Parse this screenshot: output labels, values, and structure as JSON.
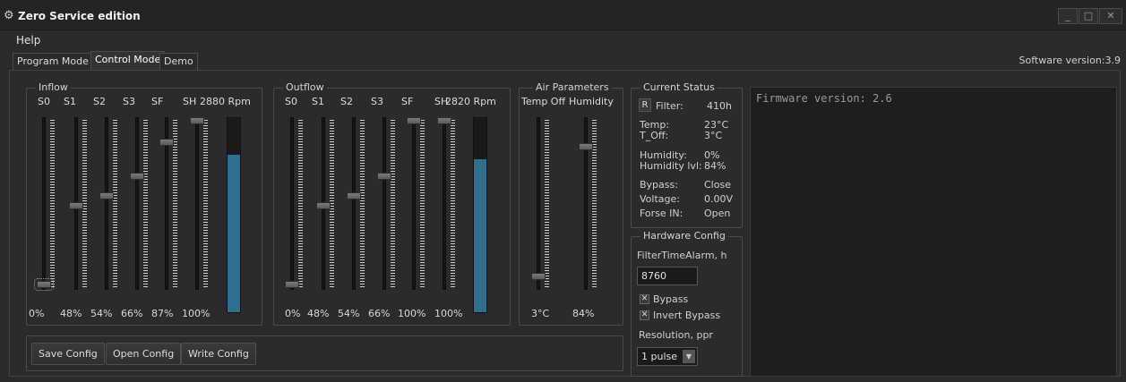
{
  "window": {
    "title": "Zero Service edition",
    "controls": [
      "_",
      "□",
      "✕"
    ]
  },
  "menu": {
    "help": "Help"
  },
  "tabs": [
    {
      "label": "Program Mode",
      "active": false
    },
    {
      "label": "Control Mode",
      "active": true
    },
    {
      "label": "Demo",
      "active": false
    }
  ],
  "software_version": "Software version:3.9",
  "inflow": {
    "title": "Inflow",
    "rpm": "2880 Rpm",
    "rpm_level": 0.81,
    "channels": [
      {
        "name": "S0",
        "value": "0%",
        "level": 0
      },
      {
        "name": "S1",
        "value": "48%",
        "level": 0.48
      },
      {
        "name": "S2",
        "value": "54%",
        "level": 0.54
      },
      {
        "name": "S3",
        "value": "66%",
        "level": 0.66
      },
      {
        "name": "SF",
        "value": "87%",
        "level": 0.87
      },
      {
        "name": "SH",
        "value": "100%",
        "level": 1.0
      }
    ]
  },
  "outflow": {
    "title": "Outflow",
    "rpm": "2820 Rpm",
    "rpm_level": 0.79,
    "channels": [
      {
        "name": "S0",
        "value": "0%",
        "level": 0
      },
      {
        "name": "S1",
        "value": "48%",
        "level": 0.48
      },
      {
        "name": "S2",
        "value": "54%",
        "level": 0.54
      },
      {
        "name": "S3",
        "value": "66%",
        "level": 0.66
      },
      {
        "name": "SF",
        "value": "100%",
        "level": 1.0
      },
      {
        "name": "SH",
        "value": "100%",
        "level": 1.0
      }
    ]
  },
  "air": {
    "title": "Air Parameters",
    "channels": [
      {
        "name": "Temp Off",
        "value": "3°C",
        "level": 0.05
      },
      {
        "name": "Humidity",
        "value": "84%",
        "level": 0.84
      }
    ]
  },
  "status": {
    "title": "Current Status",
    "reset_label": "R",
    "rows": [
      {
        "label": "Filter:",
        "value": "410h"
      },
      {
        "label": "Temp:",
        "value": "23°C"
      },
      {
        "label": "T_Off:",
        "value": "3°C"
      },
      {
        "label": "Humidity:",
        "value": "0%"
      },
      {
        "label": "Humidity lvl:",
        "value": "84%"
      },
      {
        "label": "Bypass:",
        "value": "Close"
      },
      {
        "label": "Voltage:",
        "value": "0.00V"
      },
      {
        "label": "Forse IN:",
        "value": "Open"
      }
    ]
  },
  "hardware": {
    "title": "Hardware Config",
    "filter_alarm_label": "FilterTimeAlarm, h",
    "filter_alarm_value": "8760",
    "bypass_label": "Bypass",
    "bypass_checked": true,
    "invert_bypass_label": "Invert Bypass",
    "invert_bypass_checked": true,
    "resolution_label": "Resolution, ppr",
    "resolution_value": "1 pulse"
  },
  "buttons": {
    "save": "Save Config",
    "open": "Open Config",
    "write": "Write Config"
  },
  "console": {
    "text": "Firmware version: 2.6"
  },
  "colors": {
    "rpm_fill": "#2f6f8f",
    "background": "#2b2b2b"
  }
}
